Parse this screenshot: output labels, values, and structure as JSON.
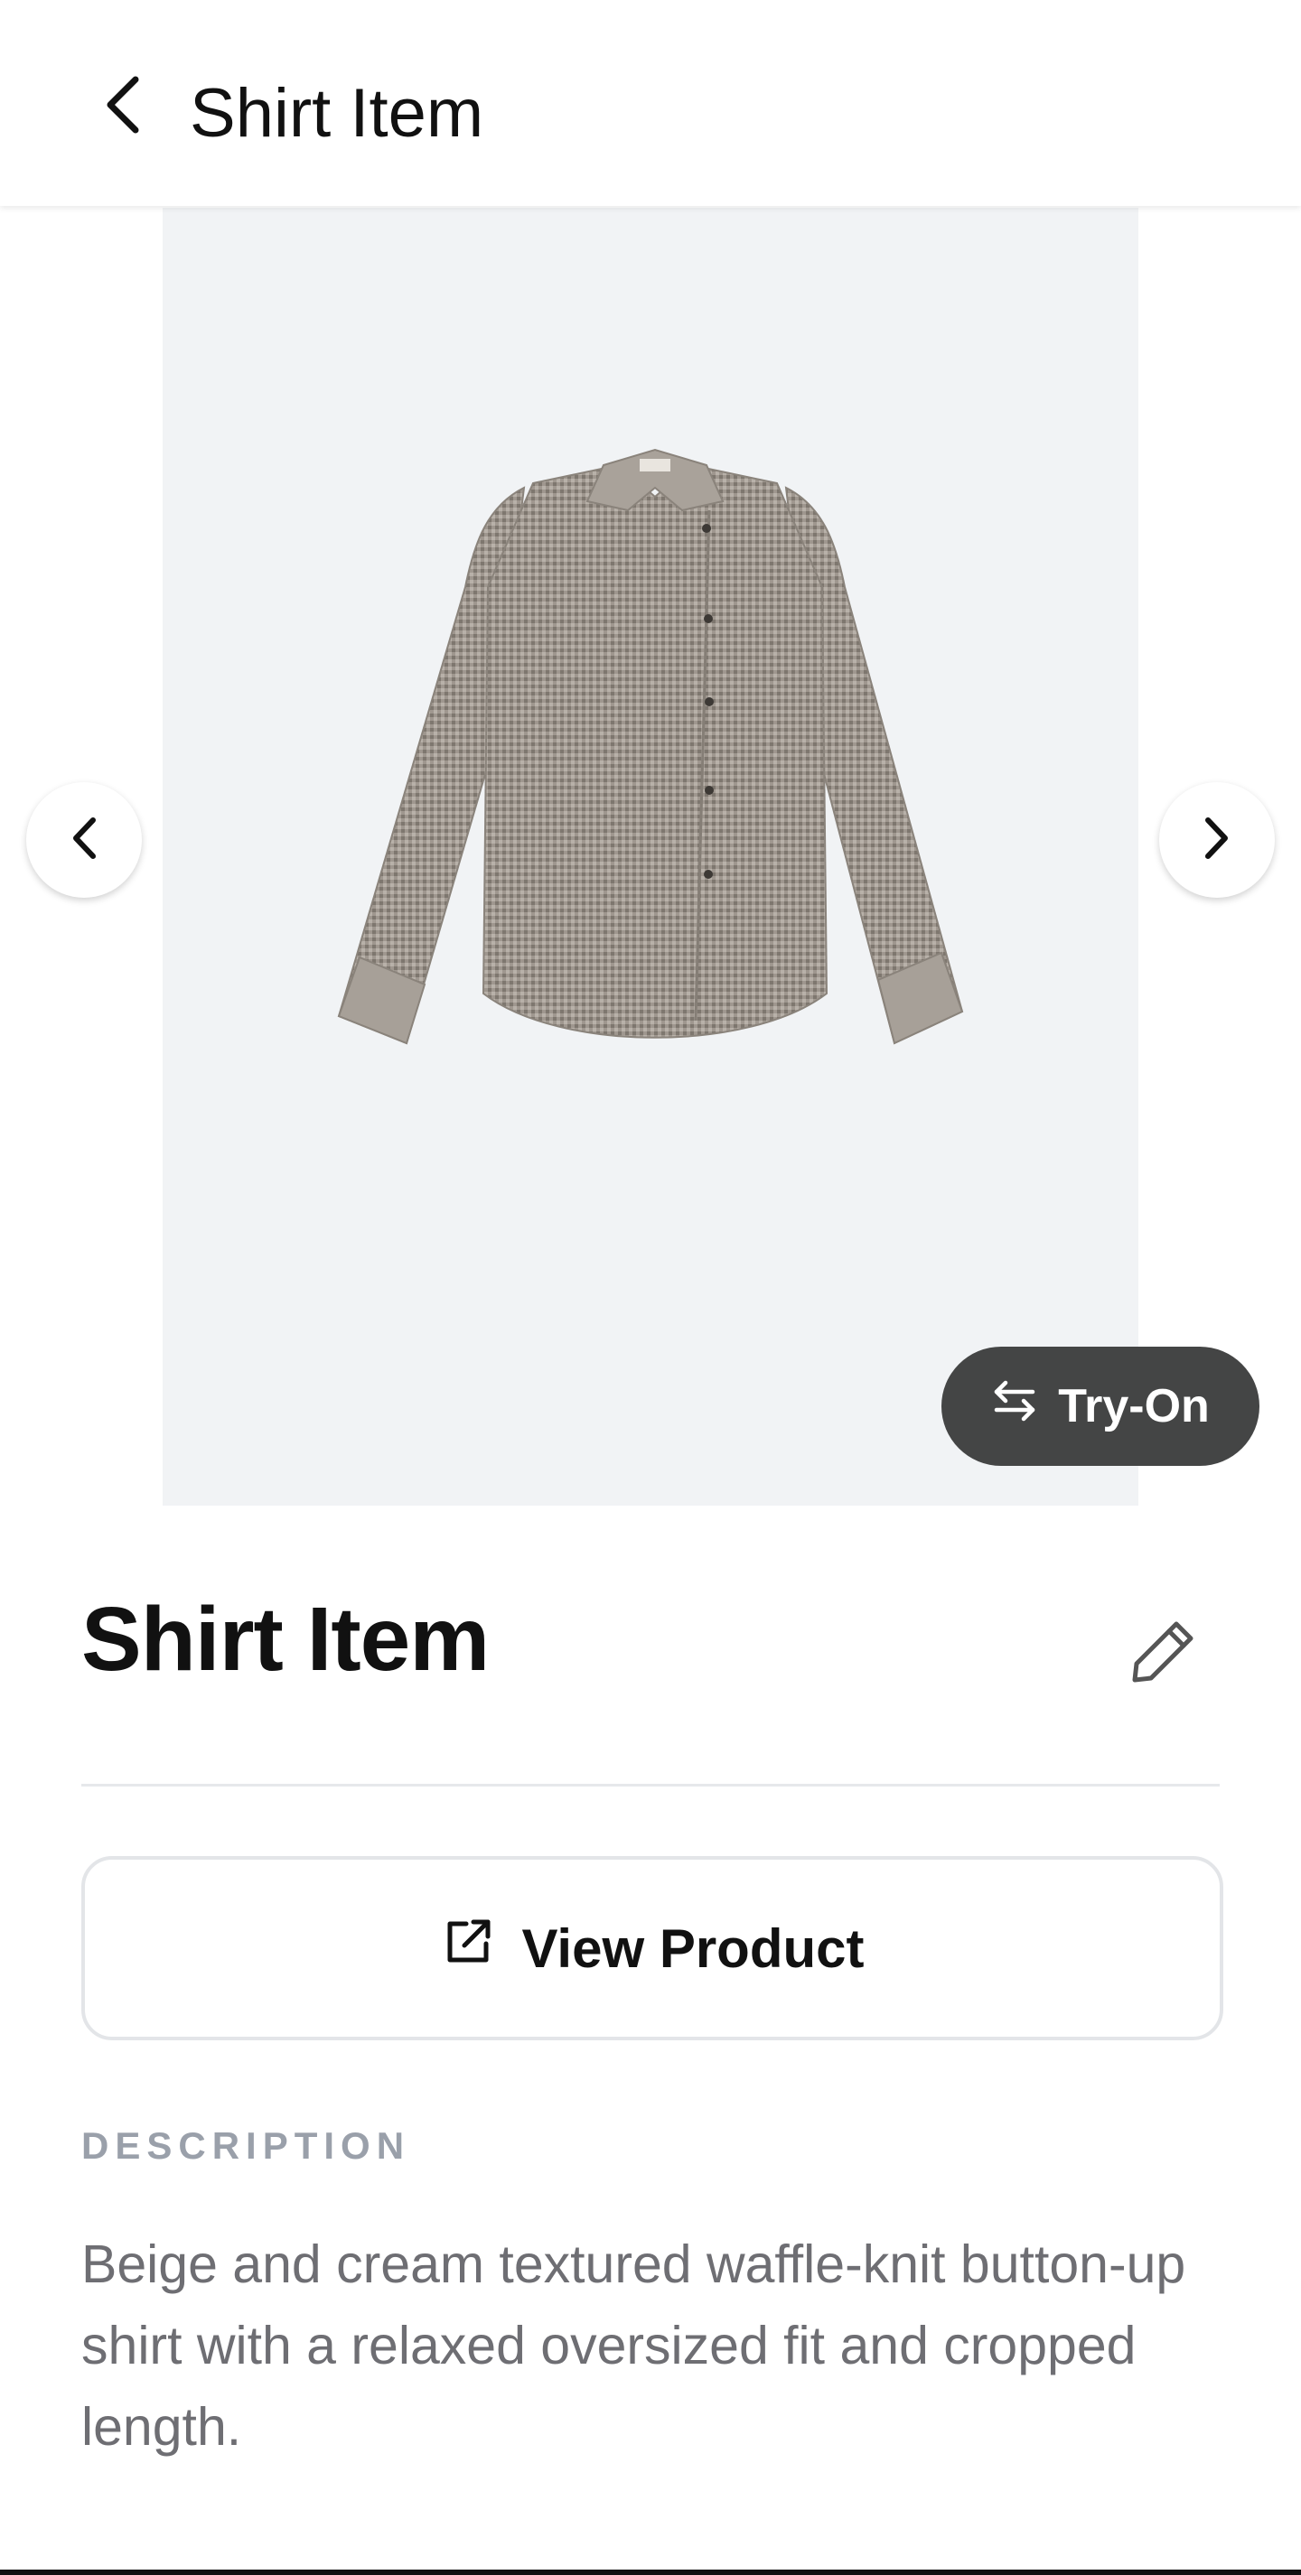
{
  "header": {
    "title": "Shirt Item",
    "back_icon": "chevron-left-icon"
  },
  "gallery": {
    "image_description_icon": "shirt-image",
    "prev_icon": "chevron-left-icon",
    "next_icon": "chevron-right-icon",
    "background_color": "#f1f3f5"
  },
  "try_on": {
    "label": "Try-On",
    "icon": "swap-arrows-icon",
    "background_color": "#444545"
  },
  "item": {
    "name": "Shirt Item",
    "edit_icon": "pencil-icon"
  },
  "view_product": {
    "label": "View Product",
    "icon": "external-link-icon"
  },
  "description": {
    "heading": "DESCRIPTION",
    "text": "Beige and cream textured waffle-knit button-up shirt with a relaxed oversized fit and cropped length."
  }
}
